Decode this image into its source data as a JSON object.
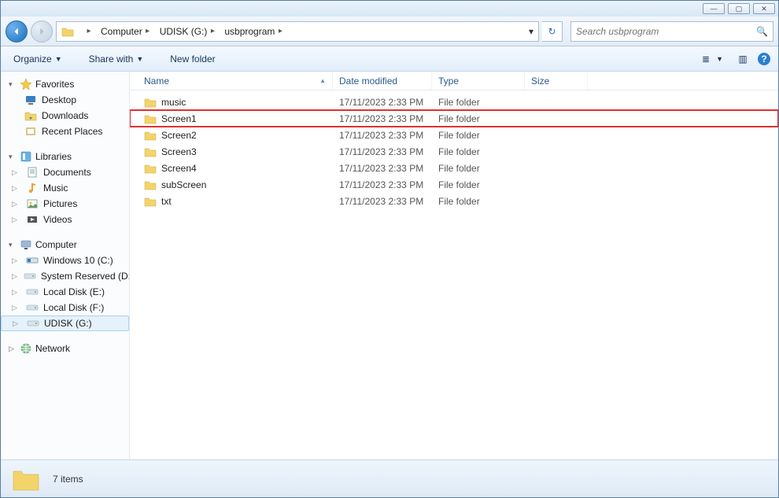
{
  "window_controls": {
    "min": "—",
    "max": "▢",
    "close": "✕"
  },
  "breadcrumb": {
    "segments": [
      "Computer",
      "UDISK (G:)",
      "usbprogram"
    ]
  },
  "refresh_glyph": "↻",
  "search": {
    "placeholder": "Search usbprogram",
    "icon": "🔍"
  },
  "toolbar": {
    "organize": "Organize",
    "share": "Share with",
    "newfolder": "New folder",
    "view_icon": "≣",
    "preview_icon": "▥",
    "help_icon": "?"
  },
  "sidebar": {
    "favorites": {
      "label": "Favorites",
      "items": [
        {
          "icon": "desktop",
          "label": "Desktop"
        },
        {
          "icon": "downloads",
          "label": "Downloads"
        },
        {
          "icon": "recent",
          "label": "Recent Places"
        }
      ]
    },
    "libraries": {
      "label": "Libraries",
      "items": [
        {
          "icon": "doc",
          "label": "Documents"
        },
        {
          "icon": "music",
          "label": "Music"
        },
        {
          "icon": "pic",
          "label": "Pictures"
        },
        {
          "icon": "vid",
          "label": "Videos"
        }
      ]
    },
    "computer": {
      "label": "Computer",
      "items": [
        {
          "icon": "drive",
          "label": "Windows 10 (C:)"
        },
        {
          "icon": "drive",
          "label": "System Reserved (D:)"
        },
        {
          "icon": "drive",
          "label": "Local Disk (E:)"
        },
        {
          "icon": "drive",
          "label": "Local Disk (F:)"
        },
        {
          "icon": "drive",
          "label": "UDISK (G:)",
          "selected": true
        }
      ]
    },
    "network": {
      "label": "Network"
    }
  },
  "columns": {
    "name": "Name",
    "date": "Date modified",
    "type": "Type",
    "size": "Size"
  },
  "rows": [
    {
      "name": "music",
      "date": "17/11/2023 2:33 PM",
      "type": "File folder",
      "highlight": false
    },
    {
      "name": "Screen1",
      "date": "17/11/2023 2:33 PM",
      "type": "File folder",
      "highlight": true
    },
    {
      "name": "Screen2",
      "date": "17/11/2023 2:33 PM",
      "type": "File folder",
      "highlight": false
    },
    {
      "name": "Screen3",
      "date": "17/11/2023 2:33 PM",
      "type": "File folder",
      "highlight": false
    },
    {
      "name": "Screen4",
      "date": "17/11/2023 2:33 PM",
      "type": "File folder",
      "highlight": false
    },
    {
      "name": "subScreen",
      "date": "17/11/2023 2:33 PM",
      "type": "File folder",
      "highlight": false
    },
    {
      "name": "txt",
      "date": "17/11/2023 2:33 PM",
      "type": "File folder",
      "highlight": false
    }
  ],
  "status": {
    "count": "7 items"
  }
}
